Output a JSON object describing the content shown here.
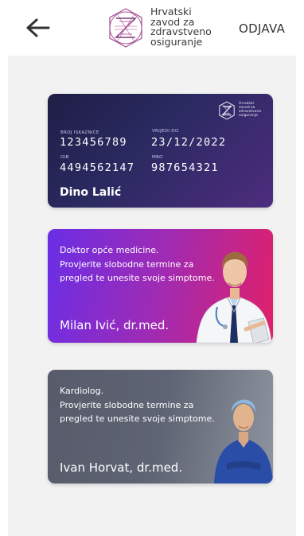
{
  "header": {
    "logo_text": "Hrvatski\nzavod za\nzdravstveno\nosiguranje",
    "logout_label": "ODJAVA",
    "accent": "#7a3a78"
  },
  "id_card": {
    "logo_text": "Hrvatski\nzavod za\nzdravstveno\nosiguranje",
    "card_no_label": "BROJ ISKAZNICE",
    "card_no": "123456789",
    "valid_label": "VRIJEDI DO",
    "valid": "23/12/2022",
    "oib_label": "OIB",
    "oib": "4494562147",
    "mbo_label": "MBO",
    "mbo": "987654321",
    "holder": "Dino Lalić"
  },
  "doctors": [
    {
      "description": "Doktor opće medicine.\nProvjerite slobodne termine za\npregled te unesite svoje simptome.",
      "name": "Milan Ivić, dr.med.",
      "icon": "doctor-photo"
    },
    {
      "description": "Kardiolog.\nProvjerite slobodne termine za\npregled te unesite svoje simptome.",
      "name": "Ivan Horvat, dr.med.",
      "icon": "doctor-photo"
    }
  ]
}
